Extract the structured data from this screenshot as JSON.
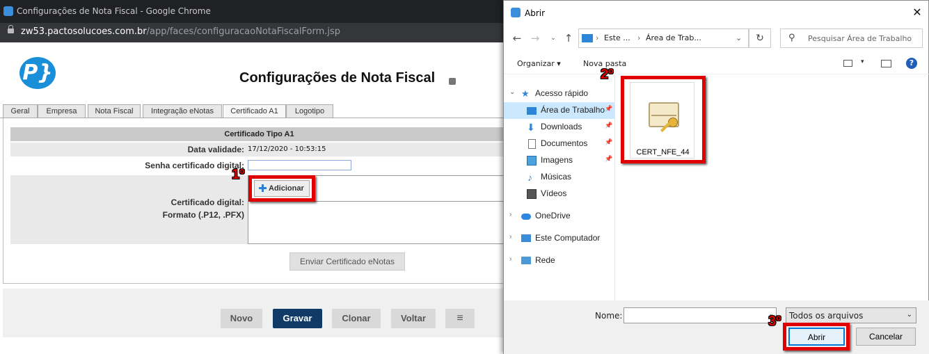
{
  "browser": {
    "title": "Configurações de Nota Fiscal - Google Chrome",
    "url_host": "zw53.pactosolucoes.com.br",
    "url_path": "/app/faces/configuracaoNotaFiscalForm.jsp"
  },
  "page": {
    "logo_text": "P}",
    "title": "Configurações de Nota Fiscal",
    "tabs": [
      {
        "label": "Geral"
      },
      {
        "label": "Empresa"
      },
      {
        "label": "Nota Fiscal"
      },
      {
        "label": "Integração eNotas"
      },
      {
        "label": "Certificado A1",
        "active": true
      },
      {
        "label": "Logotipo"
      }
    ],
    "section_title": "Certificado Tipo A1",
    "fields": {
      "validade_label": "Data validade:",
      "validade_value": "17/12/2020 - 10:53:15",
      "senha_label": "Senha certificado digital:",
      "senha_value": "",
      "cert_label": "Certificado digital:",
      "format_label": "Formato (.P12, .PFX)",
      "add_button": "Adicionar"
    },
    "send_button": "Enviar Certificado eNotas",
    "actions": {
      "novo": "Novo",
      "gravar": "Gravar",
      "clonar": "Clonar",
      "voltar": "Voltar",
      "list_icon": "≡"
    }
  },
  "annotations": {
    "step1": "1º",
    "step2": "2º",
    "step3": "3º",
    "color": "#e10000"
  },
  "dialog": {
    "title": "Abrir",
    "address": [
      "Este ...",
      "Área de Trab..."
    ],
    "search_placeholder": "Pesquisar Área de Trabalho",
    "toolbar": {
      "organize": "Organizar",
      "new_folder": "Nova pasta"
    },
    "nav": [
      {
        "label": "Acesso rápido",
        "icon": "star-icon"
      },
      {
        "label": "Área de Trabalho",
        "icon": "desktop-icon",
        "selected": true
      },
      {
        "label": "Downloads",
        "icon": "download-icon"
      },
      {
        "label": "Documentos",
        "icon": "documents-icon"
      },
      {
        "label": "Imagens",
        "icon": "images-icon"
      },
      {
        "label": "Músicas",
        "icon": "music-icon"
      },
      {
        "label": "Vídeos",
        "icon": "videos-icon"
      },
      {
        "label": "OneDrive",
        "icon": "cloud-icon"
      },
      {
        "label": "Este Computador",
        "icon": "computer-icon"
      },
      {
        "label": "Rede",
        "icon": "network-icon"
      }
    ],
    "files": [
      {
        "name": "CERT_NFE_44",
        "icon": "certificate-icon"
      }
    ],
    "name_label": "Nome:",
    "name_value": "",
    "filter": "Todos os arquivos",
    "open_button": "Abrir",
    "cancel_button": "Cancelar",
    "help": "?"
  }
}
